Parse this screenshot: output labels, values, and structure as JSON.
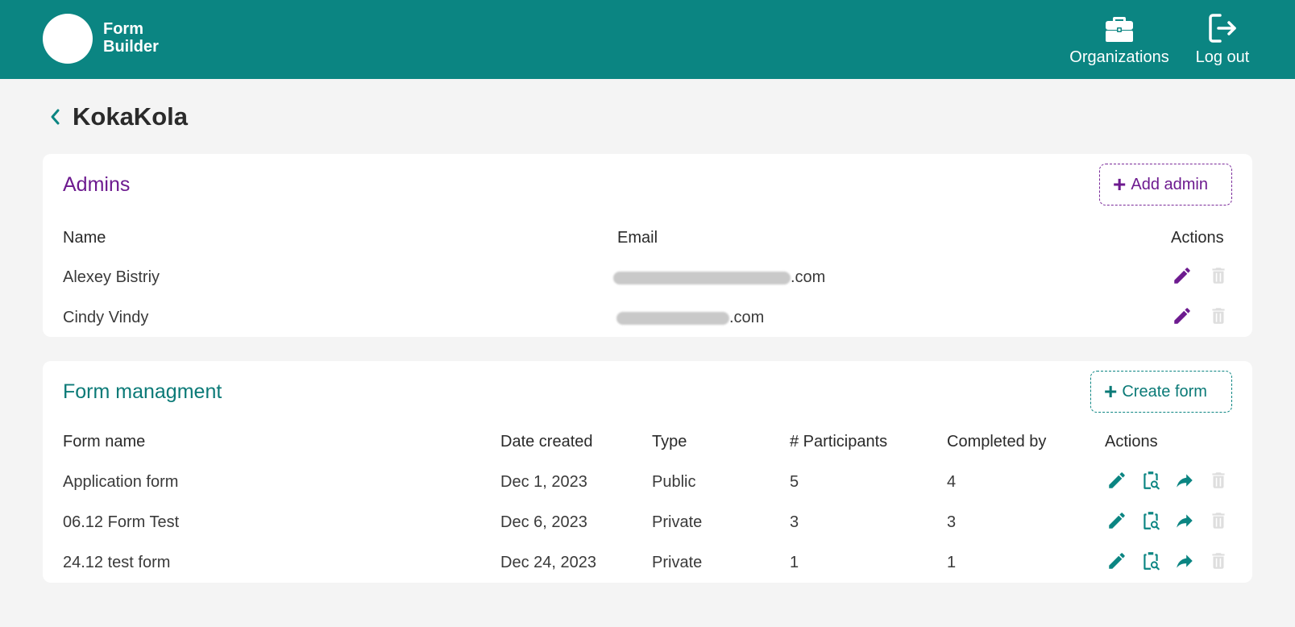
{
  "header": {
    "logo_line1": "Form",
    "logo_line2": "Builder",
    "nav_organizations": "Organizations",
    "nav_logout": "Log out",
    "background_color": "#0b8582"
  },
  "page": {
    "title": "KokaKola"
  },
  "admins": {
    "title": "Admins",
    "add_button": "Add admin",
    "columns": {
      "name": "Name",
      "email": "Email",
      "actions": "Actions"
    },
    "rows": [
      {
        "name": "Alexey Bistriy",
        "email_suffix": ".com"
      },
      {
        "name": "Cindy Vindy",
        "email_suffix": ".com"
      }
    ],
    "accent_color": "#6d1a8f"
  },
  "forms": {
    "title": "Form managment",
    "create_button": "Create form",
    "columns": {
      "form_name": "Form name",
      "date_created": "Date created",
      "type": "Type",
      "participants": "# Participants",
      "completed_by": "Completed by",
      "actions": "Actions"
    },
    "rows": [
      {
        "form_name": "Application form",
        "date_created": "Dec 1, 2023",
        "type": "Public",
        "participants": "5",
        "completed_by": "4"
      },
      {
        "form_name": "06.12 Form Test",
        "date_created": "Dec 6, 2023",
        "type": "Private",
        "participants": "3",
        "completed_by": "3"
      },
      {
        "form_name": "24.12 test form",
        "date_created": "Dec 24, 2023",
        "type": "Private",
        "participants": "1",
        "completed_by": "1"
      }
    ],
    "accent_color": "#0b8582"
  },
  "icons": {
    "edit": "pencil-icon",
    "results": "clipboard-search-icon",
    "share": "share-arrow-icon",
    "delete": "trash-icon",
    "back": "chevron-left-icon",
    "organizations": "briefcase-icon",
    "logout": "logout-icon"
  }
}
